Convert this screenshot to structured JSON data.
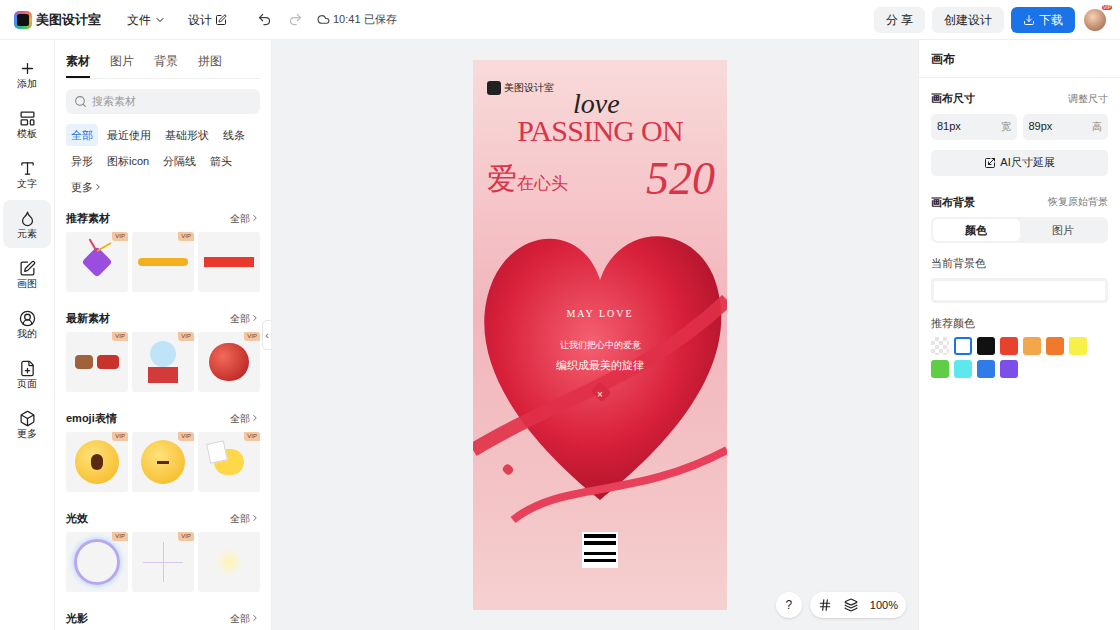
{
  "topbar": {
    "app_name": "美图设计室",
    "menus": [
      {
        "label": "文件"
      },
      {
        "label": "设计"
      }
    ],
    "save_status": "10:41 已保存",
    "buttons": [
      {
        "label": "分 享",
        "kind": "plain"
      },
      {
        "label": "创建设计",
        "kind": "plain"
      },
      {
        "label": "下载",
        "kind": "primary"
      }
    ],
    "avatar_badge": "VIP"
  },
  "rail": {
    "items": [
      {
        "label": "添加",
        "selected": false
      },
      {
        "label": "模板",
        "selected": false
      },
      {
        "label": "文字",
        "selected": false
      },
      {
        "label": "元素",
        "selected": true
      },
      {
        "label": "画图",
        "selected": false
      },
      {
        "label": "我的",
        "selected": false
      },
      {
        "label": "页面",
        "selected": false
      },
      {
        "label": "更多",
        "selected": false
      }
    ]
  },
  "panel": {
    "tabs": [
      {
        "label": "素材",
        "selected": true
      },
      {
        "label": "图片",
        "selected": false
      },
      {
        "label": "背景",
        "selected": false
      },
      {
        "label": "拼图",
        "selected": false
      }
    ],
    "search": {
      "placeholder": "搜索素材"
    },
    "chips": [
      {
        "label": "全部",
        "selected": true
      },
      {
        "label": "最近使用",
        "selected": false
      },
      {
        "label": "基础形状",
        "selected": false
      },
      {
        "label": "线条",
        "selected": false
      },
      {
        "label": "异形",
        "selected": false
      },
      {
        "label": "图标icon",
        "selected": false
      },
      {
        "label": "分隔线",
        "selected": false
      },
      {
        "label": "箭头",
        "selected": false
      },
      {
        "label": "更多",
        "selected": false
      }
    ],
    "sections": [
      {
        "title": "推荐素材",
        "more": "全部",
        "items": [
          {
            "kind": "party",
            "vip": true
          },
          {
            "kind": "stroke",
            "vip": true
          },
          {
            "kind": "bar",
            "vip": false
          }
        ]
      },
      {
        "title": "最新素材",
        "more": "全部",
        "items": [
          {
            "kind": "reindeer",
            "vip": true
          },
          {
            "kind": "gift",
            "vip": true
          },
          {
            "kind": "apple",
            "vip": true
          }
        ]
      },
      {
        "title": "emoji表情",
        "more": "全部",
        "items": [
          {
            "kind": "shock",
            "vip": true
          },
          {
            "kind": "think",
            "vip": true
          },
          {
            "kind": "chick",
            "vip": true
          }
        ]
      },
      {
        "title": "光效",
        "more": "全部",
        "items": [
          {
            "kind": "ring",
            "vip": true
          },
          {
            "kind": "sparkle",
            "vip": true
          },
          {
            "kind": "glow",
            "vip": false
          }
        ]
      },
      {
        "title": "光影",
        "more": "全部",
        "items": []
      }
    ],
    "vip_label": "VIP",
    "collapse": "‹"
  },
  "canvas": {
    "poster": {
      "brand": "美图设计室",
      "script": "love",
      "headline": "PASSING ON",
      "title_big": "爱",
      "title_small": "在心头",
      "number": "520",
      "subtitle": "MAY LOVE",
      "line1": "让我们把心中的爱意",
      "line2": "编织成最美的旋律",
      "divider": "×"
    },
    "toolbar": {
      "help": "?",
      "zoom": "100%"
    }
  },
  "right": {
    "title": "画布",
    "size": {
      "label": "画布尺寸",
      "action": "调整尺寸",
      "width": "81px",
      "width_unit": "宽",
      "height": "89px",
      "height_unit": "高"
    },
    "ai_button": "AI尺寸延展",
    "background": {
      "label": "画布背景",
      "action": "恢复原始背景",
      "modes": [
        {
          "label": "颜色",
          "selected": true
        },
        {
          "label": "图片",
          "selected": false
        }
      ],
      "current_label": "当前背景色",
      "current_color": "#ffffff",
      "recommended_label": "推荐颜色",
      "swatches": [
        {
          "kind": "transparent",
          "color": "#eeeeee",
          "selected": false
        },
        {
          "kind": "solid",
          "color": "#ffffff",
          "selected": true
        },
        {
          "kind": "solid",
          "color": "#111111",
          "selected": false
        },
        {
          "kind": "solid",
          "color": "#e8412c",
          "selected": false
        },
        {
          "kind": "solid",
          "color": "#f4a74a",
          "selected": false
        },
        {
          "kind": "solid",
          "color": "#f07a2c",
          "selected": false
        },
        {
          "kind": "solid",
          "color": "#f7f047",
          "selected": false
        },
        {
          "kind": "solid",
          "color": "#5fce45",
          "selected": false
        },
        {
          "kind": "solid",
          "color": "#5de8ee",
          "selected": false
        },
        {
          "kind": "solid",
          "color": "#2f7be8",
          "selected": false
        },
        {
          "kind": "solid",
          "color": "#7b4fe8",
          "selected": false
        }
      ]
    }
  }
}
